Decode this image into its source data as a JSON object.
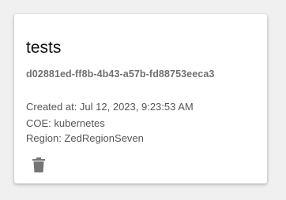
{
  "card": {
    "title": "tests",
    "id": "d02881ed-ff8b-4b43-a57b-fd88753eeca3",
    "created_at": "Created at: Jul 12, 2023, 9:23:53 AM",
    "coe": "COE: kubernetes",
    "region": "Region: ZedRegionSeven",
    "delete_icon": "trash-icon"
  },
  "colors": {
    "background": "#f0f0f0",
    "card": "#ffffff",
    "title": "#111111",
    "id_text": "#707070",
    "meta_text": "#555555",
    "icon": "#757575"
  }
}
